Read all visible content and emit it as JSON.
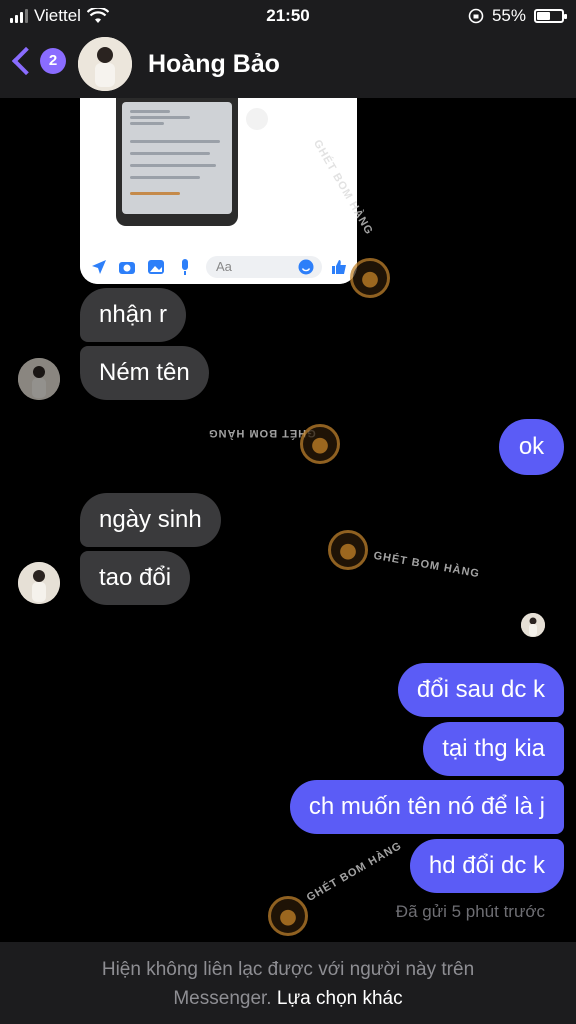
{
  "status_bar": {
    "carrier": "Viettel",
    "time": "21:50",
    "battery": "55%",
    "battery_level": 0.55
  },
  "header": {
    "back_count": "2",
    "contact_name": "Hoàng Bảo"
  },
  "shared_image": {
    "input_placeholder": "Aa"
  },
  "messages": {
    "in_1": "nhận r",
    "in_2": "Ném tên",
    "out_1": "ok",
    "in_3": "ngày sinh",
    "in_4": "tao đổi",
    "out_2": "đổi sau dc k",
    "out_3": "tại thg kia",
    "out_4": "ch muốn tên nó để là j",
    "out_5": "hd đổi dc k"
  },
  "sent_status": "Đã gửi 5 phút trước",
  "footer": {
    "notice": "Hiện không liên lạc được với người này trên",
    "notice_end": "Messenger.",
    "link": "Lựa chọn khác"
  },
  "watermark": "GHÉT BOM HÀNG",
  "colors": {
    "accent": "#8a6cff",
    "outgoing_bubble": "#5b5cf6",
    "incoming_bubble": "#3a3a3c"
  }
}
